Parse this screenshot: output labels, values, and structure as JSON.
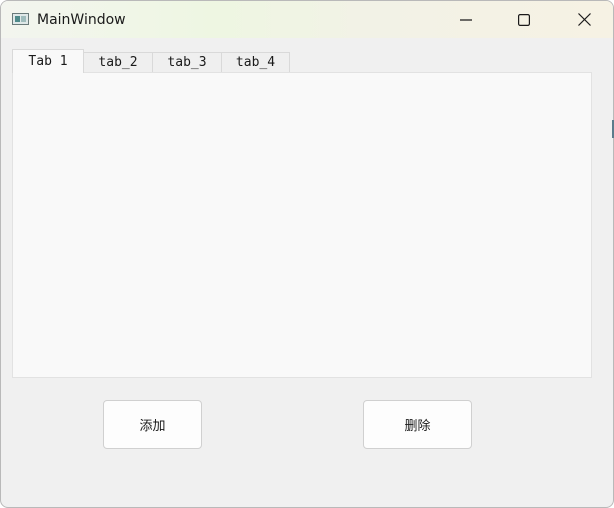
{
  "window": {
    "title": "MainWindow",
    "icon": "app-window-icon",
    "controls": {
      "minimize_icon": "minimize-icon",
      "maximize_icon": "maximize-icon",
      "close_icon": "close-icon"
    }
  },
  "tabs": [
    {
      "label": "Tab 1",
      "active": true
    },
    {
      "label": "tab_2",
      "active": false
    },
    {
      "label": "tab_3",
      "active": false
    },
    {
      "label": "tab_4",
      "active": false
    }
  ],
  "buttons": {
    "add_label": "添加",
    "delete_label": "删除"
  }
}
